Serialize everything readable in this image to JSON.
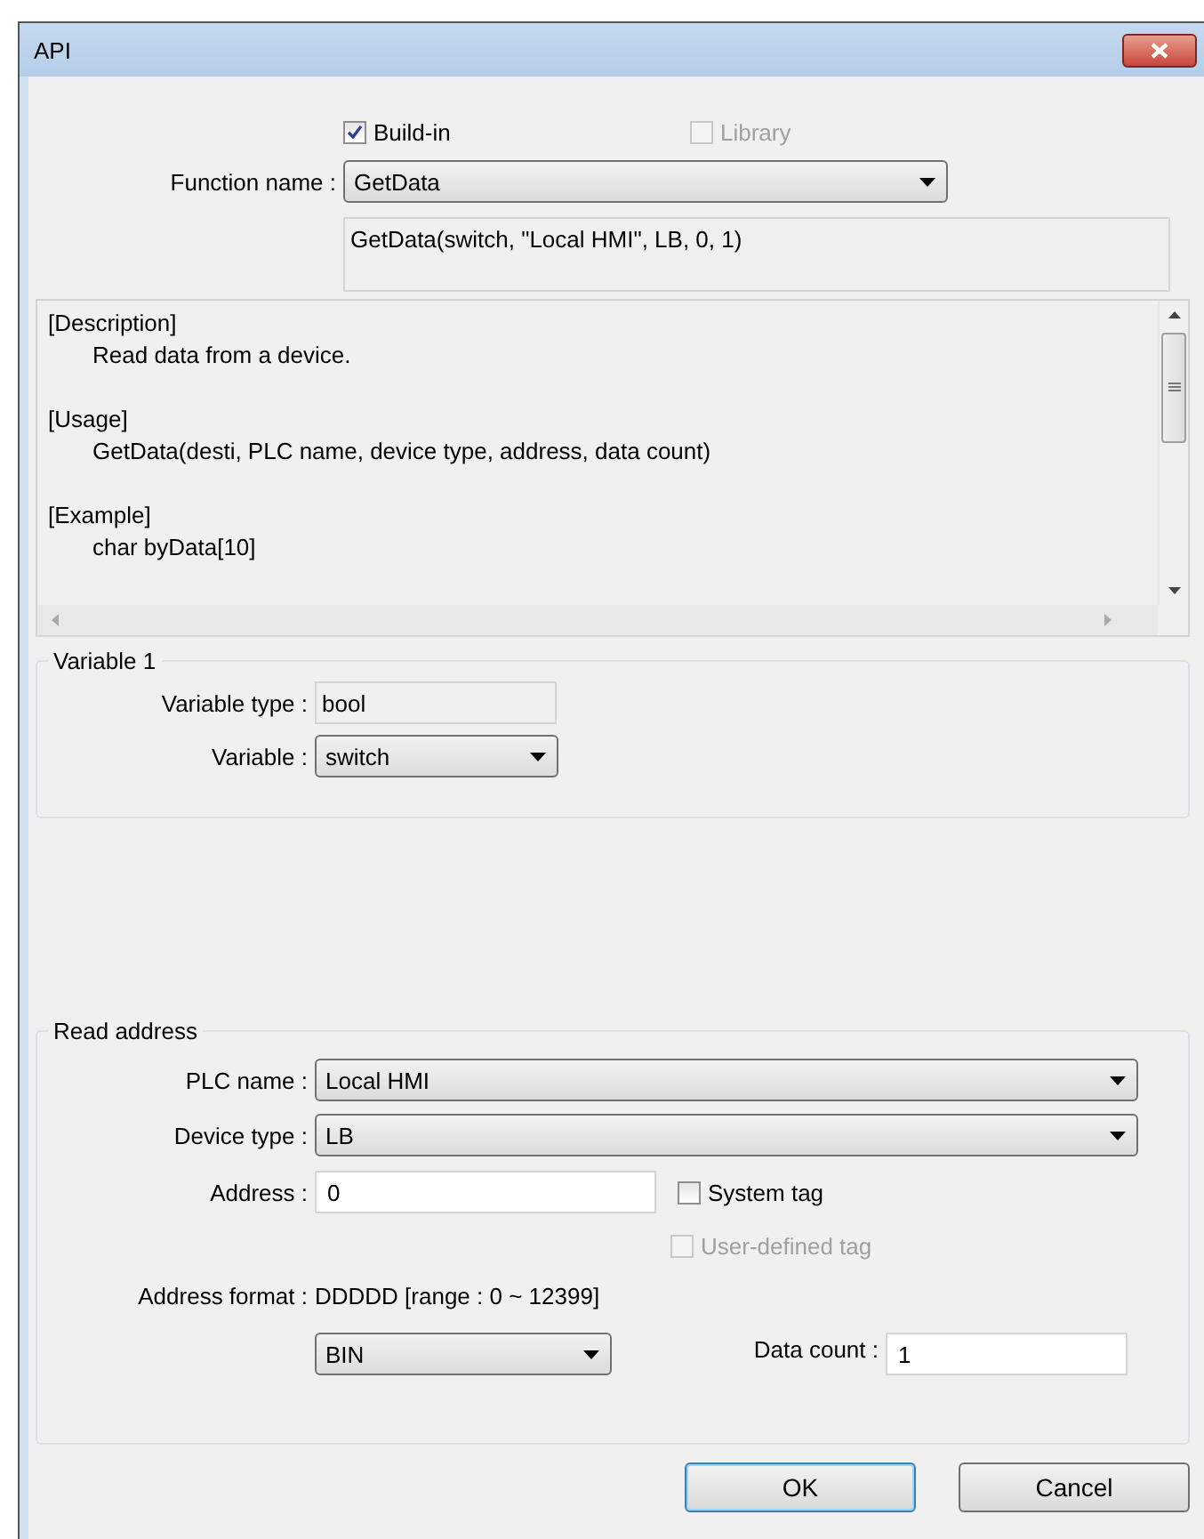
{
  "window": {
    "title": "API"
  },
  "source_options": [
    {
      "label": "Build-in",
      "checked": true,
      "disabled": false
    },
    {
      "label": "Library",
      "checked": false,
      "disabled": true
    }
  ],
  "function_name": {
    "label": "Function name :",
    "value": "GetData"
  },
  "formula": "GetData(switch, \"Local HMI\", LB, 0, 1)",
  "description": [
    {
      "heading": "[Description]",
      "lines": [
        "Read data from a device."
      ]
    },
    {
      "heading": "[Usage]",
      "lines": [
        "GetData(desti, PLC name, device type, address, data count)"
      ]
    },
    {
      "heading": "[Example]",
      "lines": [
        "char byData[10]"
      ]
    }
  ],
  "variable_group": {
    "title": "Variable 1",
    "type_label": "Variable type :",
    "type_value": "bool",
    "variable_label": "Variable :",
    "variable_value": "switch"
  },
  "read_address": {
    "title": "Read address",
    "plc_name": {
      "label": "PLC name :",
      "value": "Local HMI"
    },
    "device_type": {
      "label": "Device type :",
      "value": "LB"
    },
    "address": {
      "label": "Address :",
      "value": "0"
    },
    "tags": [
      {
        "label": "System tag",
        "checked": false,
        "disabled": false
      },
      {
        "label": "User-defined tag",
        "checked": false,
        "disabled": true
      }
    ],
    "address_format": {
      "label": "Address format :",
      "value": "DDDDD [range : 0 ~ 12399]"
    },
    "format": "BIN",
    "data_count": {
      "label": "Data count :",
      "value": "1"
    }
  },
  "buttons": [
    {
      "label": "OK",
      "default": true
    },
    {
      "label": "Cancel",
      "default": false
    }
  ]
}
